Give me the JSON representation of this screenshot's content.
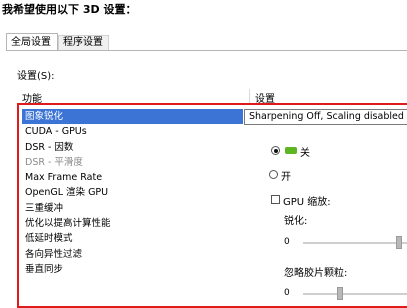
{
  "heading": "我希望使用以下 3D 设置：",
  "tabs": [
    {
      "label": "全局设置",
      "active": true
    },
    {
      "label": "程序设置",
      "active": false
    }
  ],
  "settings_label": "设置(S):",
  "columns": {
    "feature": "功能",
    "setting": "设置"
  },
  "features": [
    {
      "label": "图象锐化",
      "selected": true
    },
    {
      "label": "CUDA - GPUs"
    },
    {
      "label": "DSR - 因数"
    },
    {
      "label": "DSR - 平滑度",
      "disabled": true
    },
    {
      "label": "Max Frame Rate"
    },
    {
      "label": "OpenGL 渲染 GPU"
    },
    {
      "label": "三重缓冲"
    },
    {
      "label": "优化以提高计算性能"
    },
    {
      "label": "低延时模式"
    },
    {
      "label": "各向异性过滤"
    },
    {
      "label": "垂直同步"
    }
  ],
  "selected_value": "Sharpening Off, Scaling disabled",
  "panel": {
    "radio_off_label": "关",
    "radio_on_label": "开",
    "gpu_scaling_label": "GPU 缩放:",
    "sharpen_label": "锐化:",
    "sharpen_min": "0",
    "ignore_grain_label": "忽略胶片颗粒:",
    "grain_min": "0"
  },
  "colors": {
    "selection": "#3b74d4",
    "highlight_border": "#e01b1b",
    "nvidia_green": "#5cb521"
  }
}
